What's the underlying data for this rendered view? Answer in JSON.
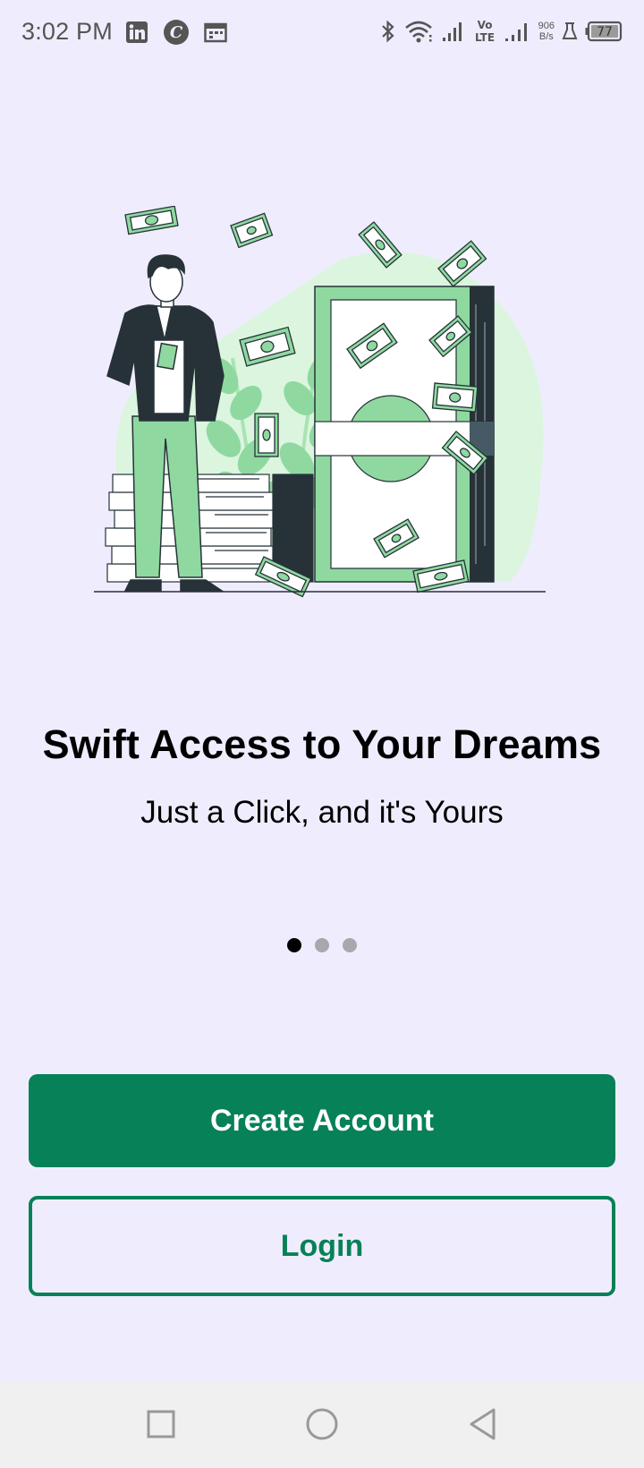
{
  "status_bar": {
    "time": "3:02 PM",
    "speed_value": "906",
    "speed_unit": "B/s",
    "battery": "77",
    "left_icons": [
      "linkedin-icon",
      "c-app-icon",
      "calendar-icon"
    ],
    "right_icons": [
      "bluetooth-icon",
      "wifi-icon",
      "signal-icon",
      "volte-icon",
      "signal-icon-2",
      "flask-icon",
      "battery-icon"
    ]
  },
  "onboarding": {
    "title": "Swift Access to Your Dreams",
    "subtitle": "Just a Click, and it's Yours",
    "page_count": 3,
    "active_page": 1
  },
  "actions": {
    "create_account_label": "Create Account",
    "login_label": "Login"
  },
  "nav": {
    "items": [
      "recents-square-icon",
      "home-circle-icon",
      "back-triangle-icon"
    ]
  },
  "colors": {
    "background": "#efedfd",
    "primary": "#078157",
    "illustration_green": "#8fd9a0",
    "illustration_light": "#dcf5df",
    "illustration_dark": "#263238"
  }
}
